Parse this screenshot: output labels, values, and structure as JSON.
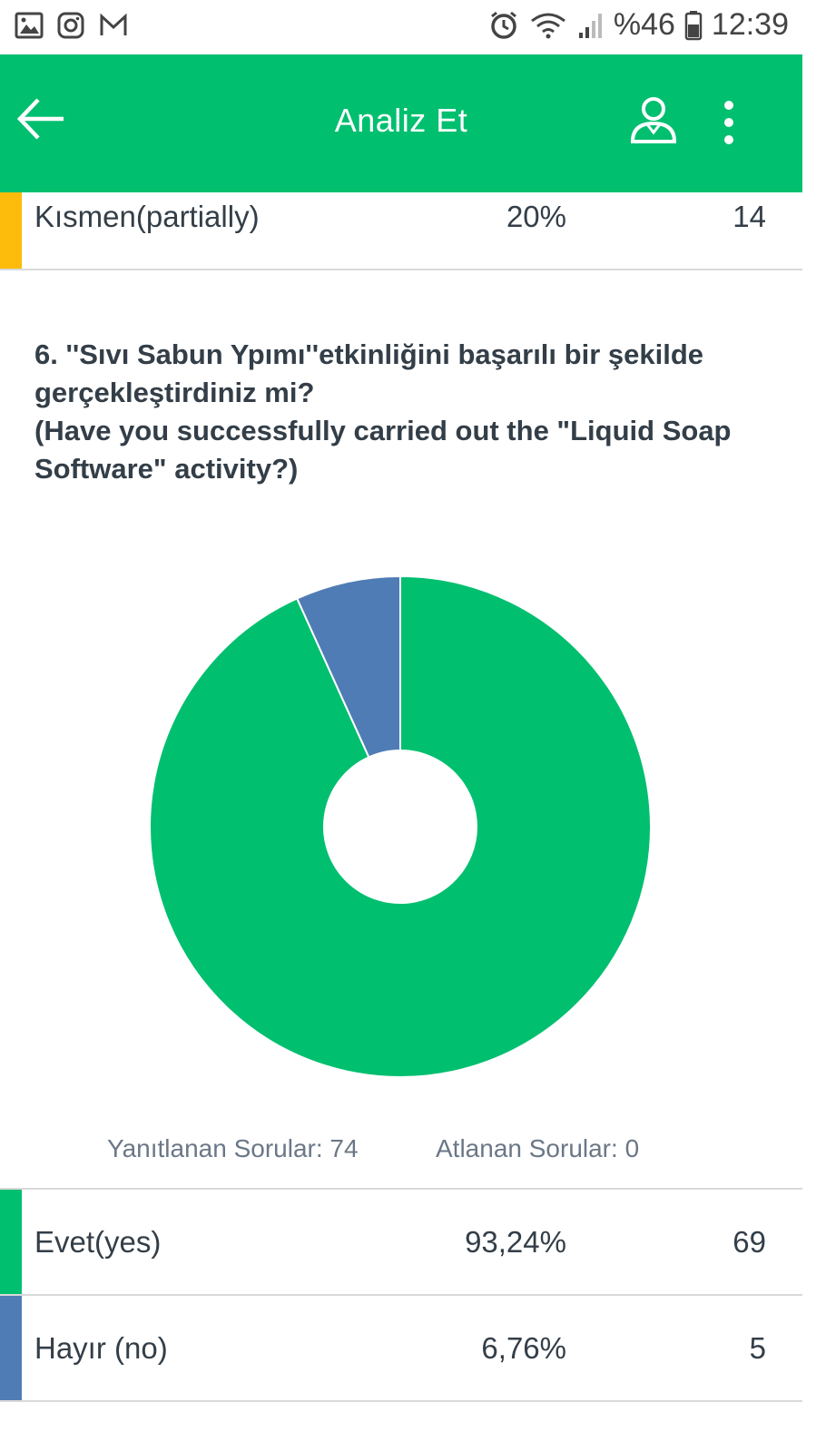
{
  "status_bar": {
    "battery": "%46",
    "time": "12:39",
    "icons": [
      "gallery-icon",
      "instagram-icon",
      "gmail-icon",
      "alarm-icon",
      "wifi-icon",
      "signal-icon",
      "battery-icon"
    ]
  },
  "app_bar": {
    "title": "Analiz Et",
    "icons": [
      "back-arrow-icon",
      "user-icon",
      "more-vertical-icon"
    ]
  },
  "previous_row": {
    "label": "Kısmen(partially)",
    "percent": "20%",
    "count": "14",
    "color": "#fdbc0b"
  },
  "question": {
    "lines": [
      "6. ''Sıvı Sabun Ypımı''etkinliğini başarılı bir şekilde",
      "gerçekleştirdiniz mi?",
      "(Have you successfully carried out the \"Liquid Soap",
      "Software\" activity?)"
    ]
  },
  "chart_data": {
    "type": "pie",
    "title": "",
    "categories": [
      "Evet(yes)",
      "Hayır (no)"
    ],
    "values": [
      93.24,
      6.76
    ],
    "colors": [
      "#00bf6f",
      "#507cb6"
    ],
    "donut": true
  },
  "stats": {
    "answered": "Yanıtlanan Sorular: 74",
    "skipped": "Atlanan Sorular: 0"
  },
  "answers": [
    {
      "label": "Evet(yes)",
      "percent": "93,24%",
      "count": "69",
      "color": "#00bf6f"
    },
    {
      "label": "Hayır (no)",
      "percent": "6,76%",
      "count": "5",
      "color": "#507cb6"
    }
  ]
}
